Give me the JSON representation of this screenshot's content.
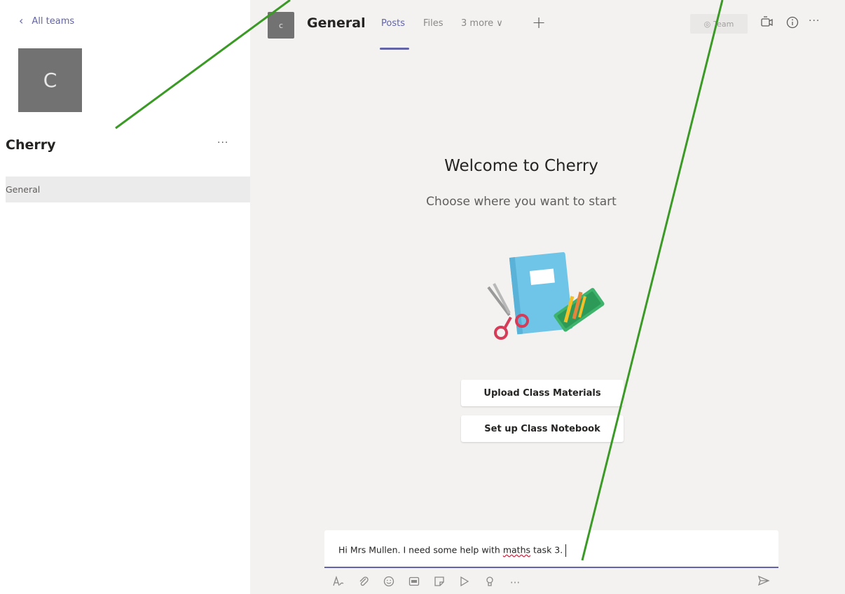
{
  "sidebar": {
    "back_label": "All teams",
    "team_initial": "C",
    "team_name": "Cherry",
    "more": "···",
    "channels": [
      {
        "label": "General"
      }
    ]
  },
  "header": {
    "avatar_initial": "c",
    "channel_name": "General",
    "tabs": [
      {
        "label": "Posts"
      },
      {
        "label": "Files"
      },
      {
        "label": "3 more ∨"
      }
    ],
    "add_tab": "+",
    "team_button": "Team",
    "more": "···"
  },
  "welcome": {
    "title": "Welcome to Cherry",
    "subtitle": "Choose where you want to start"
  },
  "actions": [
    {
      "label": "Upload Class Materials"
    },
    {
      "label": "Set up Class Notebook"
    }
  ],
  "compose": {
    "text_before": "Hi Mrs Mullen. I need some help with ",
    "text_misspelled": "maths",
    "text_after": " task 3."
  },
  "toolbar": {
    "more": "···"
  },
  "colors": {
    "accent": "#6264a7",
    "annotation_arrow": "#3a9a25"
  }
}
